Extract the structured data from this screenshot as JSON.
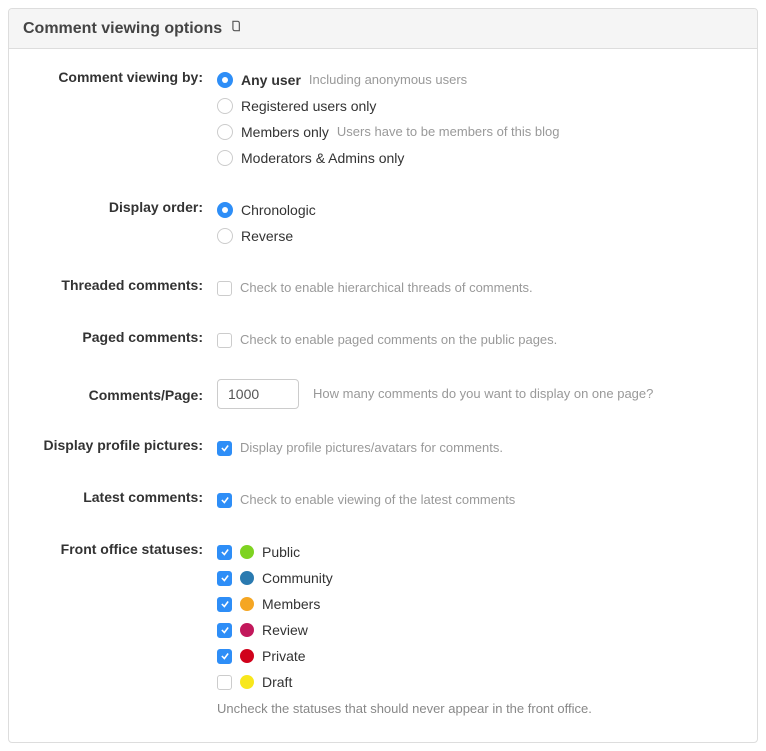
{
  "header": {
    "title": "Comment viewing options"
  },
  "viewing_by": {
    "label": "Comment viewing by:",
    "options": [
      {
        "label": "Any user",
        "hint": "Including anonymous users",
        "checked": true
      },
      {
        "label": "Registered users only",
        "hint": "",
        "checked": false
      },
      {
        "label": "Members only",
        "hint": "Users have to be members of this blog",
        "checked": false
      },
      {
        "label": "Moderators & Admins only",
        "hint": "",
        "checked": false
      }
    ]
  },
  "display_order": {
    "label": "Display order:",
    "options": [
      {
        "label": "Chronologic",
        "checked": true
      },
      {
        "label": "Reverse",
        "checked": false
      }
    ]
  },
  "threaded": {
    "label": "Threaded comments:",
    "checked": false,
    "text": "Check to enable hierarchical threads of comments."
  },
  "paged": {
    "label": "Paged comments:",
    "checked": false,
    "text": "Check to enable paged comments on the public pages."
  },
  "per_page": {
    "label": "Comments/Page:",
    "value": "1000",
    "hint": "How many comments do you want to display on one page?"
  },
  "profile_pics": {
    "label": "Display profile pictures:",
    "checked": true,
    "text": "Display profile pictures/avatars for comments."
  },
  "latest": {
    "label": "Latest comments:",
    "checked": true,
    "text": "Check to enable viewing of the latest comments"
  },
  "statuses": {
    "label": "Front office statuses:",
    "items": [
      {
        "label": "Public",
        "checked": true,
        "color": "#7ed321"
      },
      {
        "label": "Community",
        "checked": true,
        "color": "#2a7ab0"
      },
      {
        "label": "Members",
        "checked": true,
        "color": "#f5a623"
      },
      {
        "label": "Review",
        "checked": true,
        "color": "#d0021b"
      },
      {
        "label": "Private",
        "checked": true,
        "color": "#e6194b"
      },
      {
        "label": "Draft",
        "checked": false,
        "color": "#f8e71c"
      }
    ],
    "status_colors": {
      "Public": "#7ed321",
      "Community": "#2a7ab0",
      "Members": "#f5a623",
      "Review": "#c2185b",
      "Private": "#d0021b",
      "Draft": "#f8e71c"
    },
    "desc": "Uncheck the statuses that should never appear in the front office."
  }
}
